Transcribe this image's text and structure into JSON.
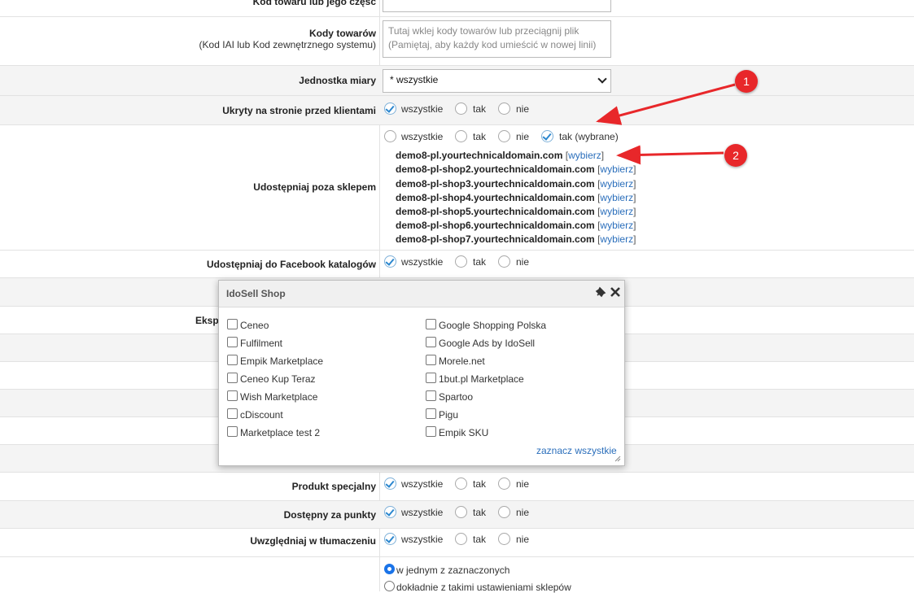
{
  "form": {
    "row_code_label": "Kod towaru lub jego część",
    "codes": {
      "label": "Kody towarów",
      "sublabel": "(Kod IAI lub Kod zewnętrznego systemu)",
      "placeholder_line1": "Tutaj wklej kody towarów lub przeciągnij plik",
      "placeholder_line2": "(Pamiętaj, aby każdy kod umieścić w nowej linii)"
    },
    "unit": {
      "label": "Jednostka miary",
      "value": "* wszystkie"
    },
    "hidden": {
      "label": "Ukryty na stronie przed klientami",
      "opt_all": "wszystkie",
      "opt_yes": "tak",
      "opt_no": "nie"
    },
    "share": {
      "label": "Udostępniaj poza sklepem",
      "opt_all": "wszystkie",
      "opt_yes": "tak",
      "opt_no": "nie",
      "opt_selected": "tak (wybrane)",
      "domains": [
        "demo8-pl.yourtechnicaldomain.com",
        "demo8-pl-shop2.yourtechnicaldomain.com",
        "demo8-pl-shop3.yourtechnicaldomain.com",
        "demo8-pl-shop4.yourtechnicaldomain.com",
        "demo8-pl-shop5.yourtechnicaldomain.com",
        "demo8-pl-shop6.yourtechnicaldomain.com",
        "demo8-pl-shop7.yourtechnicaldomain.com"
      ],
      "choose": "wybierz"
    },
    "facebook": {
      "label": "Udostępniaj do Facebook katalogów",
      "opt_all": "wszystkie",
      "opt_yes": "tak",
      "opt_no": "nie"
    },
    "export_label_partial": "Eksp",
    "special": {
      "label": "Produkt specjalny",
      "opt_all": "wszystkie",
      "opt_yes": "tak",
      "opt_no": "nie"
    },
    "points": {
      "label": "Dostępny za punkty",
      "opt_all": "wszystkie",
      "opt_yes": "tak",
      "opt_no": "nie"
    },
    "translation": {
      "label": "Uwzględniaj w tłumaczeniu",
      "opt_all": "wszystkie",
      "opt_yes": "tak",
      "opt_no": "nie"
    },
    "shops_mode": {
      "opt1": "w jednym z zaznaczonych",
      "opt2": "dokładnie z takimi ustawieniami sklepów"
    }
  },
  "annotations": [
    "1",
    "2"
  ],
  "popup": {
    "title": "IdoSell Shop",
    "left": [
      "Ceneo",
      "Fulfilment",
      "Empik Marketplace",
      "Ceneo Kup Teraz",
      "Wish Marketplace",
      "cDiscount",
      "Marketplace test 2"
    ],
    "right": [
      "Google Shopping Polska",
      "Google Ads by IdoSell",
      "Morele.net",
      "1but.pl Marketplace",
      "Spartoo",
      "Pigu",
      "Empik SKU"
    ],
    "select_all": "zaznacz wszystkie"
  },
  "colors": {
    "annotation": "#e8272a",
    "link": "#2a6ebb",
    "check": "#2b87cf"
  }
}
